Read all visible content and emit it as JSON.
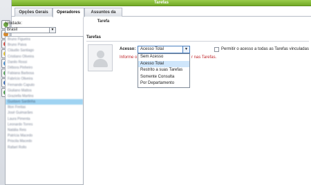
{
  "window": {
    "title": "Tarefas"
  },
  "tabs": [
    {
      "label": "Opções Gerais"
    },
    {
      "label": "Operadores"
    },
    {
      "label": "Assuntos da Tarefa"
    }
  ],
  "left_panel": {
    "unit_label": "Unidade:",
    "unit_value": "Brasil",
    "operators": [
      "Bruno Figueira",
      "Bruno Paiva",
      "Cláudio Santiago",
      "Cristiano Oliveira",
      "Danilo Rossi",
      "Débora Pinheiro",
      "Fabiana Barbosa",
      "Fabrício Oliveira",
      "Fernando Caputo",
      "Giuliano Mattos",
      "Graziella Martins",
      "Gustavo Sardinha",
      "Ilton Freitas",
      "José Guimarães",
      "Laura Pimenta",
      "Leonardo Torres",
      "Natália Reis",
      "Patrícia Macedo",
      "Priscila Macedo",
      "Rafael Rollo"
    ],
    "selected_index": 11
  },
  "main": {
    "section_title": "Tarefas",
    "acesso_label": "Acesso:",
    "acesso_value": "Acesso Total",
    "acesso_options": [
      "Sem Acesso",
      "Acesso Total",
      "Restrito a suas Tarefas",
      "Somente Consulta",
      "Por Departamento"
    ],
    "highlighted_option_index": 1,
    "info_prefix": "Informe o",
    "info_suffix": "r nas Tarefas.",
    "checkbox_label": "Permitir o acesso a todas as Tarefas vinculadas",
    "checkbox_checked": false
  },
  "toolbar_icons": [
    "edit-icon",
    "tasks-icon",
    "user-add-icon",
    "tag-icon",
    "database-icon",
    "sync-icon",
    "users-icon",
    "shuffle-icon"
  ],
  "colors": {
    "title_bar": "#7fb534",
    "selection": "#9fd3f2",
    "info_text": "#c0282d"
  }
}
